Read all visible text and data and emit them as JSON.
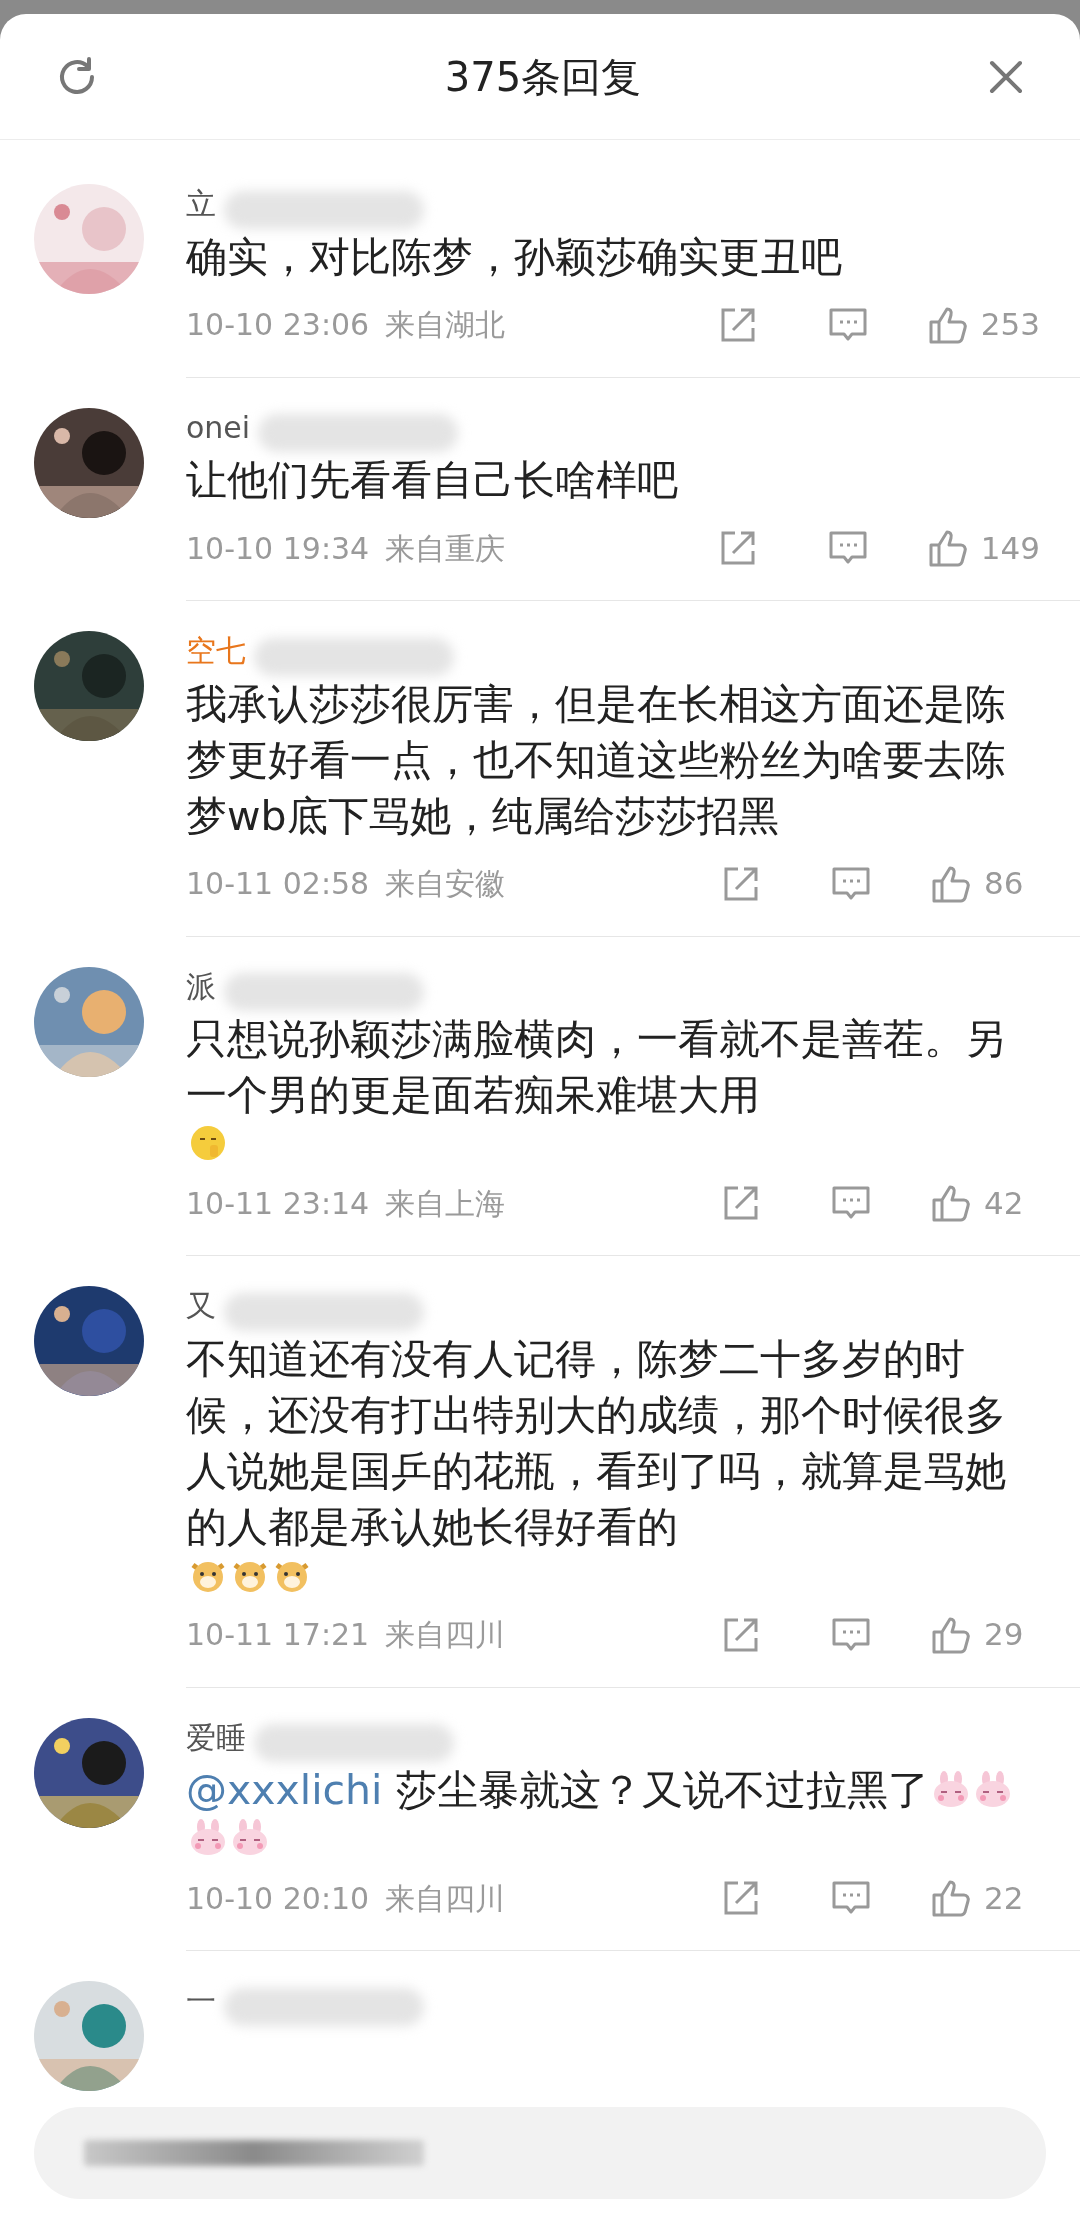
{
  "header": {
    "title": "375条回复"
  },
  "comments": [
    {
      "name": "立",
      "vip": false,
      "text": "确实，对比陈梦，孙颖莎确实更丑吧",
      "time": "10-10 23:06",
      "location": "来自湖北",
      "likes": "253"
    },
    {
      "name": "onei",
      "vip": false,
      "text": "让他们先看看自己长啥样吧",
      "time": "10-10 19:34",
      "location": "来自重庆",
      "likes": "149"
    },
    {
      "name": "空七",
      "vip": true,
      "text": "我承认莎莎很厉害，但是在长相这方面还是陈梦更好看一点，也不知道这些粉丝为啥要去陈梦wb底下骂她，纯属给莎莎招黑",
      "time": "10-11 02:58",
      "location": "来自安徽",
      "likes": "86"
    },
    {
      "name": "派",
      "vip": false,
      "text": "只想说孙颖莎满脸横肉，一看就不是善茬。另一个男的更是面若痴呆难堪大用",
      "emojis": [
        {
          "kind": "shush"
        }
      ],
      "time": "10-11 23:14",
      "location": "来自上海",
      "likes": "42"
    },
    {
      "name": "又",
      "vip": false,
      "text": "不知道还有没有人记得，陈梦二十多岁的时候，还没有打出特别大的成绩，那个时候很多人说她是国乒的花瓶，看到了吗，就算是骂她的人都是承认她长得好看的",
      "emojis": [
        {
          "kind": "dog"
        },
        {
          "kind": "dog"
        },
        {
          "kind": "dog"
        }
      ],
      "time": "10-11 17:21",
      "location": "来自四川",
      "likes": "29"
    },
    {
      "name": "爱睡",
      "vip": false,
      "mention": "@xxxlichi",
      "text": "莎尘暴就这？又说不过拉黑了",
      "emojis": [
        {
          "kind": "bunny"
        },
        {
          "kind": "bunny"
        },
        {
          "kind": "bunny"
        },
        {
          "kind": "bunny"
        }
      ],
      "time": "10-10 20:10",
      "location": "来自四川",
      "likes": "22"
    },
    {
      "name": "一",
      "vip": false
    }
  ]
}
